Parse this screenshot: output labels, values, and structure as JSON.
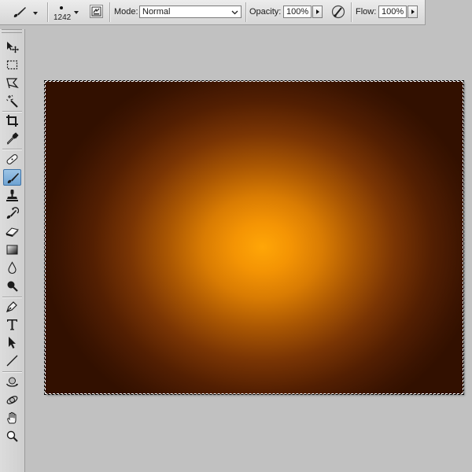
{
  "options_bar": {
    "active_tool_icon": "brush-icon",
    "brush_size": "1242",
    "brush_panel_icon": "brush-panel-toggle-icon",
    "mode_label": "Mode:",
    "mode_value": "Normal",
    "opacity_label": "Opacity:",
    "opacity_value": "100%",
    "pressure_opacity_icon": "tablet-pressure-opacity-icon",
    "flow_label": "Flow:",
    "flow_value": "100%"
  },
  "toolbox": {
    "active_tool": "brush-tool",
    "tools": [
      "move-tool",
      "marquee-tool",
      "lasso-tool",
      "magic-wand-tool",
      "crop-tool",
      "eyedropper-tool",
      "healing-brush-tool",
      "brush-tool",
      "clone-stamp-tool",
      "history-brush-tool",
      "eraser-tool",
      "gradient-tool",
      "blur-tool",
      "dodge-tool",
      "pen-tool",
      "type-tool",
      "path-selection-tool",
      "line-tool",
      "3d-rotate-tool",
      "3d-orbit-tool",
      "hand-tool",
      "zoom-tool"
    ]
  },
  "canvas": {
    "colors": {
      "center": "#ffa607",
      "edge": "#321000"
    },
    "selection": "marching-ants"
  }
}
